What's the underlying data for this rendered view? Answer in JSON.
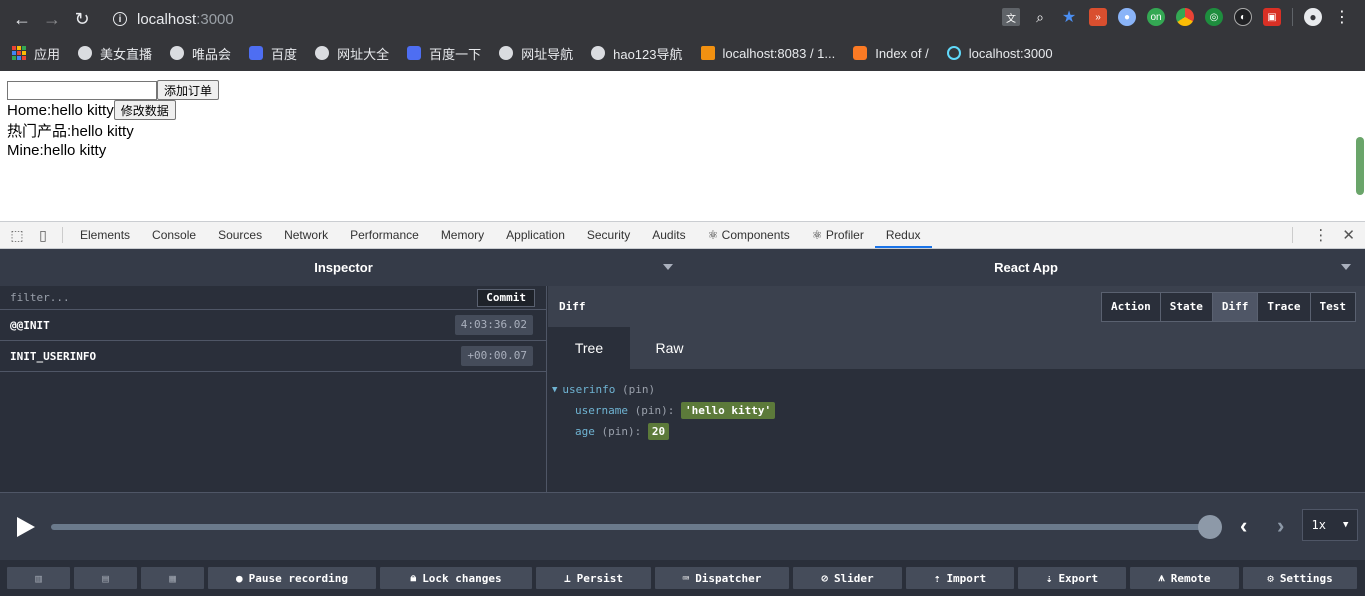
{
  "browser": {
    "url_host": "localhost",
    "url_port": ":3000",
    "bookmarks": [
      {
        "label": "应用",
        "icon": "apps-grid-icon"
      },
      {
        "label": "美女直播",
        "icon": "globe-icon"
      },
      {
        "label": "唯品会",
        "icon": "globe-icon"
      },
      {
        "label": "百度",
        "icon": "baidu-icon"
      },
      {
        "label": "网址大全",
        "icon": "globe-icon"
      },
      {
        "label": "百度一下",
        "icon": "baidu-icon"
      },
      {
        "label": "网址导航",
        "icon": "globe-icon"
      },
      {
        "label": "hao123导航",
        "icon": "globe-icon"
      },
      {
        "label": "localhost:8083 / 1...",
        "icon": "phpmyadmin-icon"
      },
      {
        "label": "Index of /",
        "icon": "xampp-icon"
      },
      {
        "label": "localhost:3000",
        "icon": "react-icon"
      }
    ]
  },
  "page": {
    "add_order_button": "添加订单",
    "home_text": "Home:hello kitty",
    "modify_button": "修改数据",
    "hot_text": "热门产品:hello kitty",
    "mine_text": "Mine:hello kitty"
  },
  "devtools": {
    "tabs": [
      "Elements",
      "Console",
      "Sources",
      "Network",
      "Performance",
      "Memory",
      "Application",
      "Security",
      "Audits",
      "⚛ Components",
      "⚛ Profiler",
      "Redux"
    ],
    "active_tab": "Redux"
  },
  "redux": {
    "inspector_title": "Inspector",
    "app_title": "React App",
    "filter_placeholder": "filter...",
    "commit_label": "Commit",
    "actions": [
      {
        "name": "@@INIT",
        "time": "4:03:36.02"
      },
      {
        "name": "INIT_USERINFO",
        "time": "+00:00.07"
      }
    ],
    "panel_title": "Diff",
    "monitor_tabs": [
      "Action",
      "State",
      "Diff",
      "Trace",
      "Test"
    ],
    "active_monitor_tab": "Diff",
    "view_tabs": [
      "Tree",
      "Raw"
    ],
    "active_view_tab": "Tree",
    "tree": {
      "root_key": "userinfo",
      "root_suffix": "(pin)",
      "rows": [
        {
          "key": "username",
          "suffix": "(pin):",
          "value": "'hello kitty'"
        },
        {
          "key": "age",
          "suffix": "(pin):",
          "value": "20"
        }
      ]
    },
    "speed": "1x",
    "bottom_buttons": [
      "Pause recording",
      "Lock changes",
      "Persist",
      "Dispatcher",
      "Slider",
      "Import",
      "Export",
      "Remote",
      "Settings"
    ]
  }
}
